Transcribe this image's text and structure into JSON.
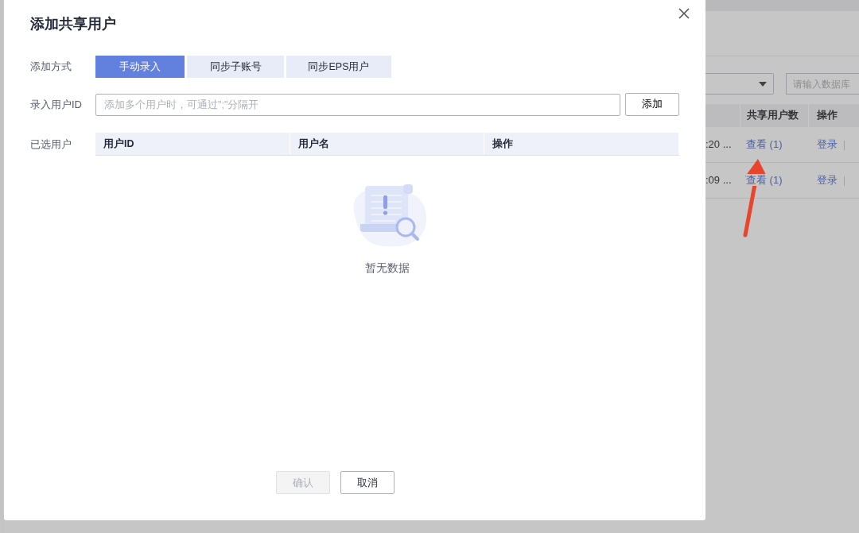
{
  "dialog": {
    "title": "添加共享用户",
    "method": {
      "label": "添加方式",
      "options": [
        {
          "label": "手动录入",
          "selected": true
        },
        {
          "label": "同步子账号",
          "selected": false
        },
        {
          "label": "同步EPS用户",
          "selected": false
        }
      ]
    },
    "user_id": {
      "label": "录入用户ID",
      "placeholder": "添加多个用户时，可通过\";\"分隔开",
      "button": "添加"
    },
    "selected_users": {
      "label": "已选用户",
      "columns": [
        "用户ID",
        "用户名",
        "操作"
      ],
      "empty_text": "暂无数据"
    },
    "buttons": [
      {
        "label": "确认",
        "disabled": true
      },
      {
        "label": "取消",
        "disabled": false
      }
    ]
  },
  "background": {
    "search": {
      "placeholder": "请输入数据库"
    },
    "table": {
      "columns": [
        "共享用户数",
        "操作"
      ],
      "rows": [
        {
          "time": ":20 ...",
          "shared": "查看 (1)",
          "actions": [
            "登录"
          ]
        },
        {
          "time": ":09 ...",
          "shared": "查看 (1)",
          "actions": [
            "登录"
          ]
        }
      ]
    }
  }
}
